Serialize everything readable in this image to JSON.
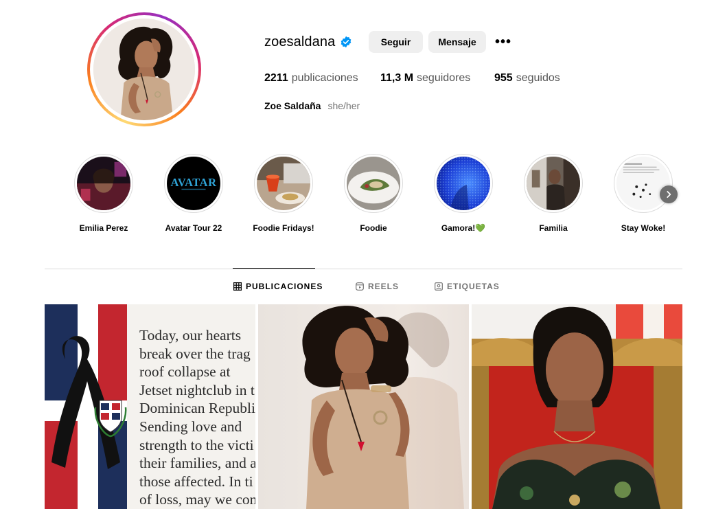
{
  "profile": {
    "username": "zoesaldana",
    "follow_label": "Seguir",
    "message_label": "Mensaje",
    "more_label": "•••",
    "posts_count": "2211",
    "posts_label": "publicaciones",
    "followers_count": "11,3 M",
    "followers_label": "seguidores",
    "following_count": "955",
    "following_label": "seguidos",
    "full_name": "Zoe Saldaña",
    "pronouns": "she/her",
    "verified_color": "#0095f6",
    "ring_colors": [
      "#feda75",
      "#fa7e1e",
      "#d62976",
      "#962fbf"
    ]
  },
  "highlights": [
    {
      "label": "Emilia Perez",
      "icon": "emilia-perez-cover"
    },
    {
      "label": "Avatar Tour 22",
      "icon": "avatar-cover",
      "cover_text": "AVATAR"
    },
    {
      "label": "Foodie Fridays!",
      "icon": "foodie-fridays-cover"
    },
    {
      "label": "Foodie",
      "icon": "foodie-cover"
    },
    {
      "label": "Gamora!💚",
      "icon": "gamora-cover"
    },
    {
      "label": "Familia",
      "icon": "familia-cover"
    },
    {
      "label": "Stay Woke!",
      "icon": "stay-woke-cover"
    }
  ],
  "tabs": [
    {
      "label": "PUBLICACIONES",
      "icon": "grid-icon",
      "active": true
    },
    {
      "label": "REELS",
      "icon": "reels-icon",
      "active": false
    },
    {
      "label": "ETIQUETAS",
      "icon": "tagged-icon",
      "active": false
    }
  ],
  "posts": [
    {
      "type": "text-card",
      "lines": [
        "Today, our hearts",
        "break over the trag",
        "roof collapse at",
        "Jetset nightclub in t",
        "Dominican Republi",
        "Sending love and",
        "strength to the victi",
        "their families, and a",
        "those affected. In ti",
        "of loss, may we com"
      ]
    },
    {
      "type": "photo",
      "icon": "portrait-photo"
    },
    {
      "type": "photo",
      "icon": "throne-photo"
    }
  ]
}
